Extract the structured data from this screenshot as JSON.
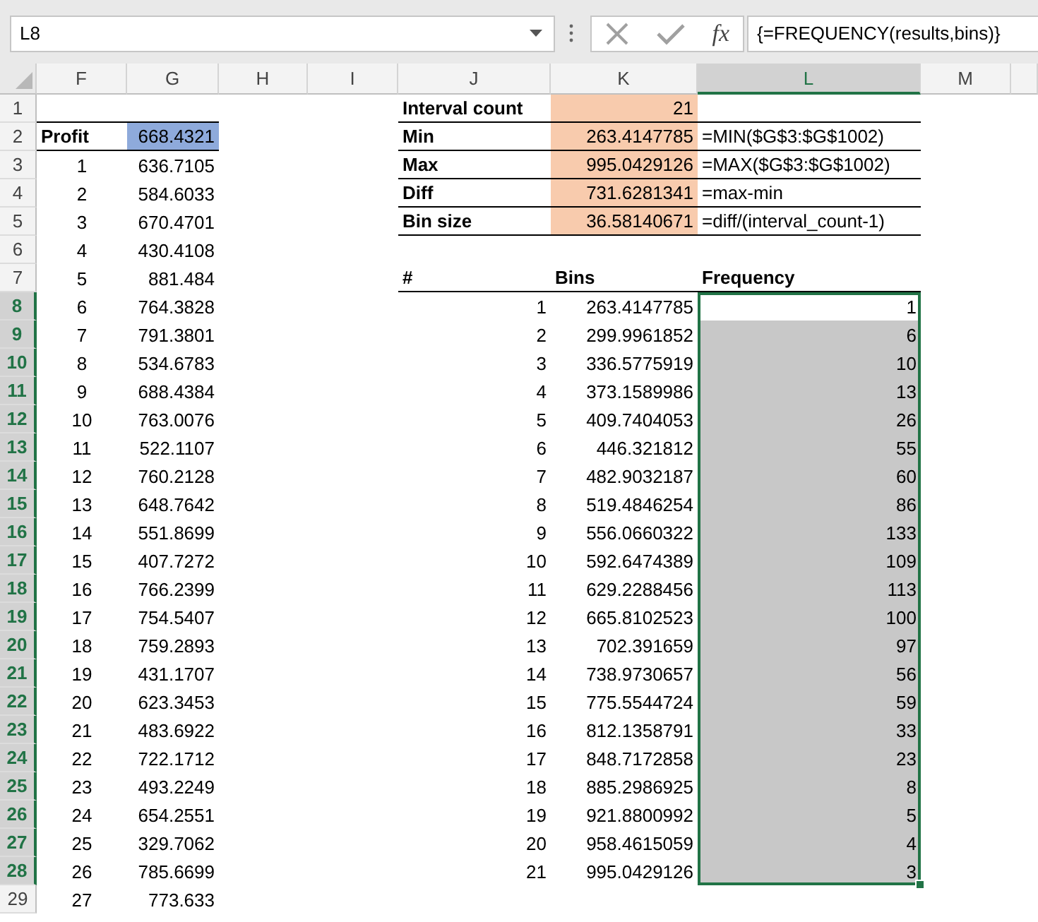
{
  "formula_bar": {
    "name_box": "L8",
    "fx_label": "fx",
    "formula": "{=FREQUENCY(results,bins)}"
  },
  "columns": [
    {
      "label": "F",
      "selected": false
    },
    {
      "label": "G",
      "selected": false
    },
    {
      "label": "H",
      "selected": false
    },
    {
      "label": "I",
      "selected": false
    },
    {
      "label": "J",
      "selected": false
    },
    {
      "label": "K",
      "selected": false
    },
    {
      "label": "L",
      "selected": true
    },
    {
      "label": "M",
      "selected": false
    }
  ],
  "rows": [
    {
      "number": "1",
      "selected": false,
      "cells": [
        {
          "underlined": true
        },
        {
          "underlined": true
        },
        {},
        {},
        {
          "text": "Interval count",
          "kind": "bold",
          "underlined": true
        },
        {
          "text": "21",
          "kind": "param",
          "underlined": true
        },
        {
          "underlined": true
        },
        {}
      ]
    },
    {
      "number": "2",
      "selected": false,
      "cells": [
        {
          "text": "Profit",
          "kind": "bold",
          "underlined": true
        },
        {
          "text": "668.4321",
          "kind": "highlight",
          "underlined": true
        },
        {},
        {},
        {
          "text": "Min",
          "kind": "bold",
          "underlined": true
        },
        {
          "text": "263.4147785",
          "kind": "param",
          "underlined": true
        },
        {
          "text": "=MIN($G$3:$G$1002)",
          "kind": "text",
          "underlined": true
        },
        {}
      ]
    },
    {
      "number": "3",
      "selected": false,
      "cells": [
        {
          "text": "1",
          "kind": "center"
        },
        {
          "text": "636.7105",
          "kind": "number"
        },
        {},
        {},
        {
          "text": "Max",
          "kind": "bold",
          "underlined": true
        },
        {
          "text": "995.0429126",
          "kind": "param",
          "underlined": true
        },
        {
          "text": "=MAX($G$3:$G$1002)",
          "kind": "text",
          "underlined": true
        },
        {}
      ]
    },
    {
      "number": "4",
      "selected": false,
      "cells": [
        {
          "text": "2",
          "kind": "center"
        },
        {
          "text": "584.6033",
          "kind": "number"
        },
        {},
        {},
        {
          "text": "Diff",
          "kind": "bold",
          "underlined": true
        },
        {
          "text": "731.6281341",
          "kind": "param",
          "underlined": true
        },
        {
          "text": "=max-min",
          "kind": "text",
          "underlined": true
        },
        {}
      ]
    },
    {
      "number": "5",
      "selected": false,
      "cells": [
        {
          "text": "3",
          "kind": "center"
        },
        {
          "text": "670.4701",
          "kind": "number"
        },
        {},
        {},
        {
          "text": "Bin size",
          "kind": "bold",
          "underlined": true
        },
        {
          "text": "36.58140671",
          "kind": "param",
          "underlined": true
        },
        {
          "text": "=diff/(interval_count-1)",
          "kind": "text",
          "underlined": true
        },
        {}
      ]
    },
    {
      "number": "6",
      "selected": false,
      "cells": [
        {
          "text": "4",
          "kind": "center"
        },
        {
          "text": "430.4108",
          "kind": "number"
        },
        {},
        {},
        {},
        {},
        {},
        {}
      ]
    },
    {
      "number": "7",
      "selected": false,
      "cells": [
        {
          "text": "5",
          "kind": "center"
        },
        {
          "text": "881.484",
          "kind": "number"
        },
        {},
        {},
        {
          "text": "#",
          "kind": "bold",
          "underlined": true
        },
        {
          "text": "Bins",
          "kind": "bold",
          "underlined": true
        },
        {
          "text": "Frequency",
          "kind": "bold",
          "underlined": true
        },
        {}
      ]
    },
    {
      "number": "8",
      "selected": true,
      "cells": [
        {
          "text": "6",
          "kind": "center"
        },
        {
          "text": "764.3828",
          "kind": "number"
        },
        {},
        {},
        {
          "text": "1",
          "kind": "number"
        },
        {
          "text": "263.4147785",
          "kind": "number"
        },
        {
          "text": "1",
          "kind": "number",
          "active": true
        },
        {}
      ]
    },
    {
      "number": "9",
      "selected": true,
      "cells": [
        {
          "text": "7",
          "kind": "center"
        },
        {
          "text": "791.3801",
          "kind": "number"
        },
        {},
        {},
        {
          "text": "2",
          "kind": "number"
        },
        {
          "text": "299.9961852",
          "kind": "number"
        },
        {
          "text": "6",
          "kind": "number"
        },
        {}
      ]
    },
    {
      "number": "10",
      "selected": true,
      "cells": [
        {
          "text": "8",
          "kind": "center"
        },
        {
          "text": "534.6783",
          "kind": "number"
        },
        {},
        {},
        {
          "text": "3",
          "kind": "number"
        },
        {
          "text": "336.5775919",
          "kind": "number"
        },
        {
          "text": "10",
          "kind": "number"
        },
        {}
      ]
    },
    {
      "number": "11",
      "selected": true,
      "cells": [
        {
          "text": "9",
          "kind": "center"
        },
        {
          "text": "688.4384",
          "kind": "number"
        },
        {},
        {},
        {
          "text": "4",
          "kind": "number"
        },
        {
          "text": "373.1589986",
          "kind": "number"
        },
        {
          "text": "13",
          "kind": "number"
        },
        {}
      ]
    },
    {
      "number": "12",
      "selected": true,
      "cells": [
        {
          "text": "10",
          "kind": "center"
        },
        {
          "text": "763.0076",
          "kind": "number"
        },
        {},
        {},
        {
          "text": "5",
          "kind": "number"
        },
        {
          "text": "409.7404053",
          "kind": "number"
        },
        {
          "text": "26",
          "kind": "number"
        },
        {}
      ]
    },
    {
      "number": "13",
      "selected": true,
      "cells": [
        {
          "text": "11",
          "kind": "center"
        },
        {
          "text": "522.1107",
          "kind": "number"
        },
        {},
        {},
        {
          "text": "6",
          "kind": "number"
        },
        {
          "text": "446.321812",
          "kind": "number"
        },
        {
          "text": "55",
          "kind": "number"
        },
        {}
      ]
    },
    {
      "number": "14",
      "selected": true,
      "cells": [
        {
          "text": "12",
          "kind": "center"
        },
        {
          "text": "760.2128",
          "kind": "number"
        },
        {},
        {},
        {
          "text": "7",
          "kind": "number"
        },
        {
          "text": "482.9032187",
          "kind": "number"
        },
        {
          "text": "60",
          "kind": "number"
        },
        {}
      ]
    },
    {
      "number": "15",
      "selected": true,
      "cells": [
        {
          "text": "13",
          "kind": "center"
        },
        {
          "text": "648.7642",
          "kind": "number"
        },
        {},
        {},
        {
          "text": "8",
          "kind": "number"
        },
        {
          "text": "519.4846254",
          "kind": "number"
        },
        {
          "text": "86",
          "kind": "number"
        },
        {}
      ]
    },
    {
      "number": "16",
      "selected": true,
      "cells": [
        {
          "text": "14",
          "kind": "center"
        },
        {
          "text": "551.8699",
          "kind": "number"
        },
        {},
        {},
        {
          "text": "9",
          "kind": "number"
        },
        {
          "text": "556.0660322",
          "kind": "number"
        },
        {
          "text": "133",
          "kind": "number"
        },
        {}
      ]
    },
    {
      "number": "17",
      "selected": true,
      "cells": [
        {
          "text": "15",
          "kind": "center"
        },
        {
          "text": "407.7272",
          "kind": "number"
        },
        {},
        {},
        {
          "text": "10",
          "kind": "number"
        },
        {
          "text": "592.6474389",
          "kind": "number"
        },
        {
          "text": "109",
          "kind": "number"
        },
        {}
      ]
    },
    {
      "number": "18",
      "selected": true,
      "cells": [
        {
          "text": "16",
          "kind": "center"
        },
        {
          "text": "766.2399",
          "kind": "number"
        },
        {},
        {},
        {
          "text": "11",
          "kind": "number"
        },
        {
          "text": "629.2288456",
          "kind": "number"
        },
        {
          "text": "113",
          "kind": "number"
        },
        {}
      ]
    },
    {
      "number": "19",
      "selected": true,
      "cells": [
        {
          "text": "17",
          "kind": "center"
        },
        {
          "text": "754.5407",
          "kind": "number"
        },
        {},
        {},
        {
          "text": "12",
          "kind": "number"
        },
        {
          "text": "665.8102523",
          "kind": "number"
        },
        {
          "text": "100",
          "kind": "number"
        },
        {}
      ]
    },
    {
      "number": "20",
      "selected": true,
      "cells": [
        {
          "text": "18",
          "kind": "center"
        },
        {
          "text": "759.2893",
          "kind": "number"
        },
        {},
        {},
        {
          "text": "13",
          "kind": "number"
        },
        {
          "text": "702.391659",
          "kind": "number"
        },
        {
          "text": "97",
          "kind": "number"
        },
        {}
      ]
    },
    {
      "number": "21",
      "selected": true,
      "cells": [
        {
          "text": "19",
          "kind": "center"
        },
        {
          "text": "431.1707",
          "kind": "number"
        },
        {},
        {},
        {
          "text": "14",
          "kind": "number"
        },
        {
          "text": "738.9730657",
          "kind": "number"
        },
        {
          "text": "56",
          "kind": "number"
        },
        {}
      ]
    },
    {
      "number": "22",
      "selected": true,
      "cells": [
        {
          "text": "20",
          "kind": "center"
        },
        {
          "text": "623.3453",
          "kind": "number"
        },
        {},
        {},
        {
          "text": "15",
          "kind": "number"
        },
        {
          "text": "775.5544724",
          "kind": "number"
        },
        {
          "text": "59",
          "kind": "number"
        },
        {}
      ]
    },
    {
      "number": "23",
      "selected": true,
      "cells": [
        {
          "text": "21",
          "kind": "center"
        },
        {
          "text": "483.6922",
          "kind": "number"
        },
        {},
        {},
        {
          "text": "16",
          "kind": "number"
        },
        {
          "text": "812.1358791",
          "kind": "number"
        },
        {
          "text": "33",
          "kind": "number"
        },
        {}
      ]
    },
    {
      "number": "24",
      "selected": true,
      "cells": [
        {
          "text": "22",
          "kind": "center"
        },
        {
          "text": "722.1712",
          "kind": "number"
        },
        {},
        {},
        {
          "text": "17",
          "kind": "number"
        },
        {
          "text": "848.7172858",
          "kind": "number"
        },
        {
          "text": "23",
          "kind": "number"
        },
        {}
      ]
    },
    {
      "number": "25",
      "selected": true,
      "cells": [
        {
          "text": "23",
          "kind": "center"
        },
        {
          "text": "493.2249",
          "kind": "number"
        },
        {},
        {},
        {
          "text": "18",
          "kind": "number"
        },
        {
          "text": "885.2986925",
          "kind": "number"
        },
        {
          "text": "8",
          "kind": "number"
        },
        {}
      ]
    },
    {
      "number": "26",
      "selected": true,
      "cells": [
        {
          "text": "24",
          "kind": "center"
        },
        {
          "text": "654.2551",
          "kind": "number"
        },
        {},
        {},
        {
          "text": "19",
          "kind": "number"
        },
        {
          "text": "921.8800992",
          "kind": "number"
        },
        {
          "text": "5",
          "kind": "number"
        },
        {}
      ]
    },
    {
      "number": "27",
      "selected": true,
      "cells": [
        {
          "text": "25",
          "kind": "center"
        },
        {
          "text": "329.7062",
          "kind": "number"
        },
        {},
        {},
        {
          "text": "20",
          "kind": "number"
        },
        {
          "text": "958.4615059",
          "kind": "number"
        },
        {
          "text": "4",
          "kind": "number"
        },
        {}
      ]
    },
    {
      "number": "28",
      "selected": true,
      "cells": [
        {
          "text": "26",
          "kind": "center"
        },
        {
          "text": "785.6699",
          "kind": "number"
        },
        {},
        {},
        {
          "text": "21",
          "kind": "number"
        },
        {
          "text": "995.0429126",
          "kind": "number"
        },
        {
          "text": "3",
          "kind": "number"
        },
        {}
      ]
    },
    {
      "number": "29",
      "selected": false,
      "cells": [
        {
          "text": "27",
          "kind": "center"
        },
        {
          "text": "773.633",
          "kind": "number"
        },
        {},
        {},
        {},
        {},
        {},
        {}
      ]
    }
  ]
}
